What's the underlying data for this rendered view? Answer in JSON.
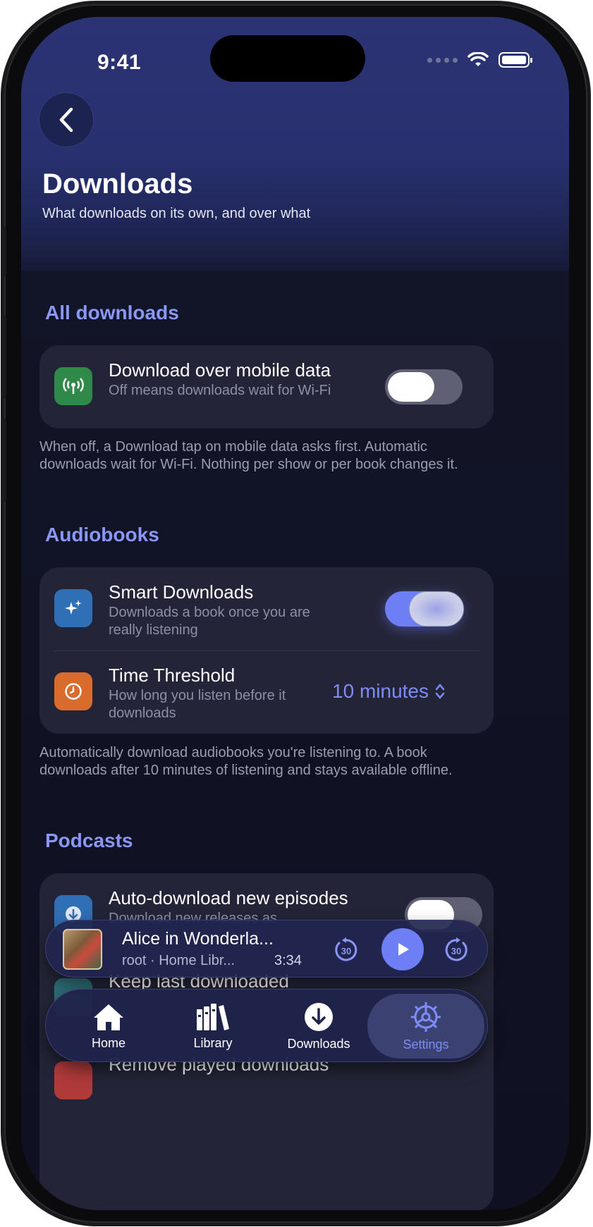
{
  "status_bar": {
    "time": "9:41"
  },
  "header": {
    "title": "Downloads",
    "subtitle": "What downloads on its own, and over what"
  },
  "sections": {
    "all_downloads": {
      "title": "All downloads",
      "row": {
        "title": "Download over mobile data",
        "description": "Off means downloads wait for Wi-Fi",
        "icon": "antenna-icon",
        "icon_color": "#2f8a4a",
        "toggle_on": false
      },
      "note": "When off, a Download tap on mobile data asks first. Automatic downloads wait for Wi-Fi. Nothing per show or per book changes it."
    },
    "audiobooks": {
      "title": "Audiobooks",
      "smart": {
        "title": "Smart Downloads",
        "description": "Downloads a book once you are really listening",
        "icon": "sparkles-icon",
        "icon_color": "#2f6fb5",
        "toggle_on": true
      },
      "threshold": {
        "title": "Time Threshold",
        "description": "How long you listen before it downloads",
        "icon": "clock-icon",
        "icon_color": "#d96b2c",
        "value": "10 minutes"
      },
      "note": "Automatically download audiobooks you're listening to. A book downloads after 10 minutes of listening and stays available offline."
    },
    "podcasts": {
      "title": "Podcasts",
      "auto": {
        "title": "Auto-download new episodes",
        "description": "Download new releases as",
        "icon": "download-icon",
        "icon_color": "#2f6fb5"
      },
      "keep": {
        "title": "Keep last downloaded"
      },
      "remove": {
        "title": "Remove played downloads"
      }
    }
  },
  "mini_player": {
    "title": "Alice in Wonderla...",
    "meta": "root · Home Libr...",
    "time": "3:34",
    "skip_back": "30",
    "skip_forward": "30"
  },
  "tabs": [
    {
      "label": "Home",
      "icon": "home-icon"
    },
    {
      "label": "Library",
      "icon": "library-icon"
    },
    {
      "label": "Downloads",
      "icon": "download-circle-icon"
    },
    {
      "label": "Settings",
      "icon": "gear-icon",
      "active": true
    }
  ],
  "colors": {
    "accent": "#7d8cf7",
    "background": "#0f1122",
    "card": "#232437"
  }
}
